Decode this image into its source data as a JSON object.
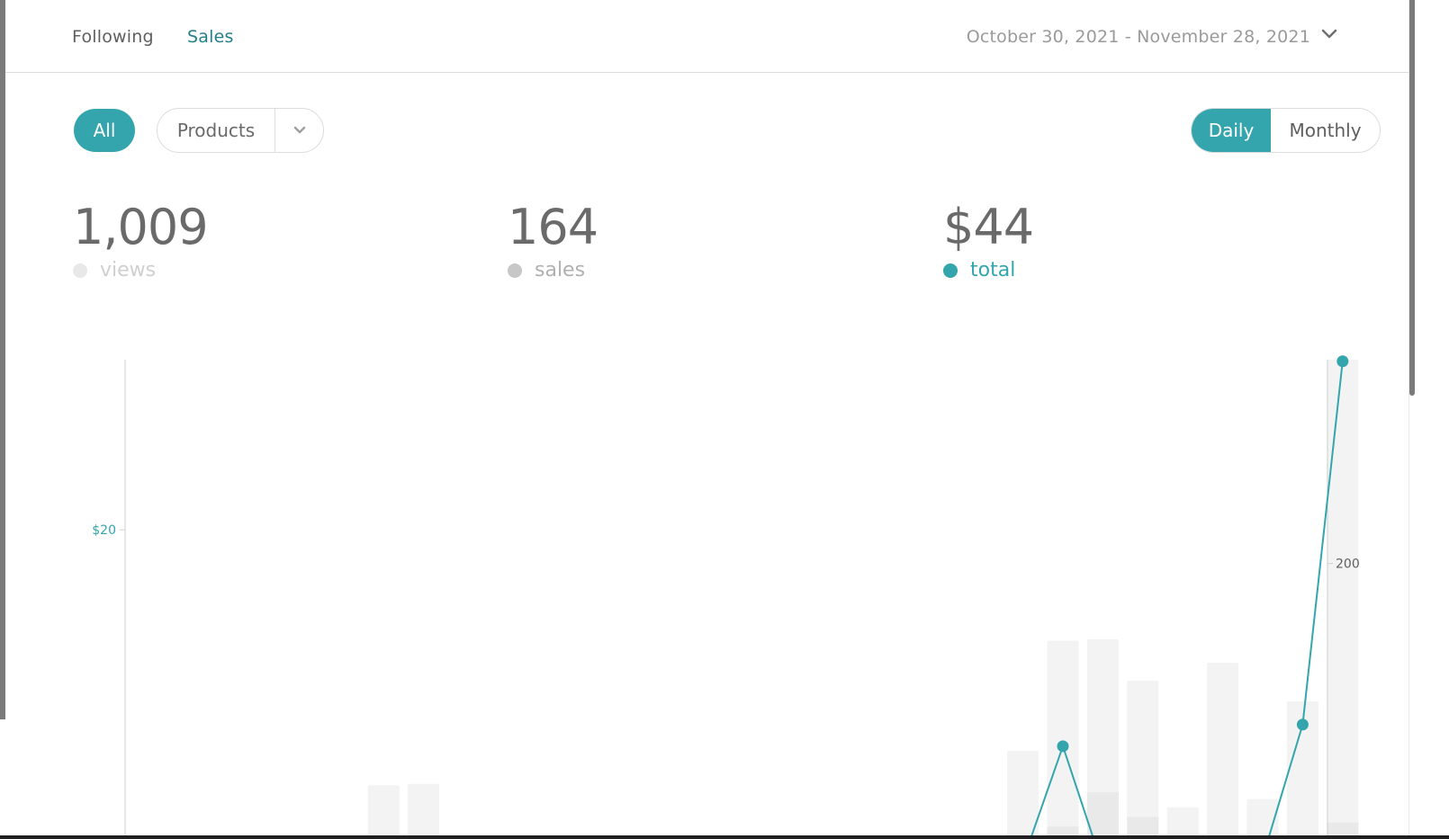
{
  "header": {
    "tabs": [
      {
        "label": "Following",
        "active": false
      },
      {
        "label": "Sales",
        "active": true
      }
    ],
    "date_range": "October 30, 2021 - November 28, 2021",
    "date_chevron_icon": "chevron-down-icon"
  },
  "filters": {
    "all_label": "All",
    "products_label": "Products",
    "products_chevron_icon": "chevron-down-icon"
  },
  "period_toggle": {
    "daily_label": "Daily",
    "monthly_label": "Monthly",
    "selected": "Daily"
  },
  "stats": {
    "views": {
      "value": "1,009",
      "label": "views"
    },
    "sales": {
      "value": "164",
      "label": "sales"
    },
    "total": {
      "value": "$44",
      "label": "total"
    }
  },
  "colors": {
    "accent": "#34a5ad",
    "accent_dark": "#247f86",
    "views_bar": "#f3f3f3",
    "sales_bar": "#e9e9e9",
    "text": "#6a6a6a",
    "muted": "#9a9a9a"
  },
  "chart_data": {
    "type": "bar",
    "axes": {
      "left": {
        "tick_labels": [
          "$20"
        ],
        "ticks": [
          20
        ],
        "range": [
          0,
          31
        ]
      },
      "right": {
        "tick_labels": [
          "200"
        ],
        "ticks": [
          200
        ],
        "range": [
          0,
          348
        ]
      }
    },
    "views_bars": [
      {
        "day": 8,
        "value": 39
      },
      {
        "day": 9,
        "value": 40
      },
      {
        "day": 24,
        "value": 64
      },
      {
        "day": 25,
        "value": 144
      },
      {
        "day": 26,
        "value": 145
      },
      {
        "day": 27,
        "value": 115
      },
      {
        "day": 28,
        "value": 23
      },
      {
        "day": 29,
        "value": 128
      },
      {
        "day": 30,
        "value": 29
      },
      {
        "day": 31,
        "value": 100
      },
      {
        "day": 32,
        "value": 348
      }
    ],
    "sales_bars": [
      {
        "day": 25,
        "value": 9
      },
      {
        "day": 26,
        "value": 34
      },
      {
        "day": 27,
        "value": 16
      },
      {
        "day": 32,
        "value": 12
      }
    ],
    "total_line": [
      {
        "day": 24,
        "value": -1.4
      },
      {
        "day": 25,
        "value": 6.0
      },
      {
        "day": 26,
        "value": -1.8
      },
      {
        "day": 30,
        "value": -1.2
      },
      {
        "day": 31,
        "value": 7.4
      },
      {
        "day": 32,
        "value": 30.9
      }
    ],
    "total_markers": [
      {
        "day": 25,
        "value": 6.0
      },
      {
        "day": 31,
        "value": 7.4
      },
      {
        "day": 32,
        "value": 30.9
      }
    ]
  }
}
